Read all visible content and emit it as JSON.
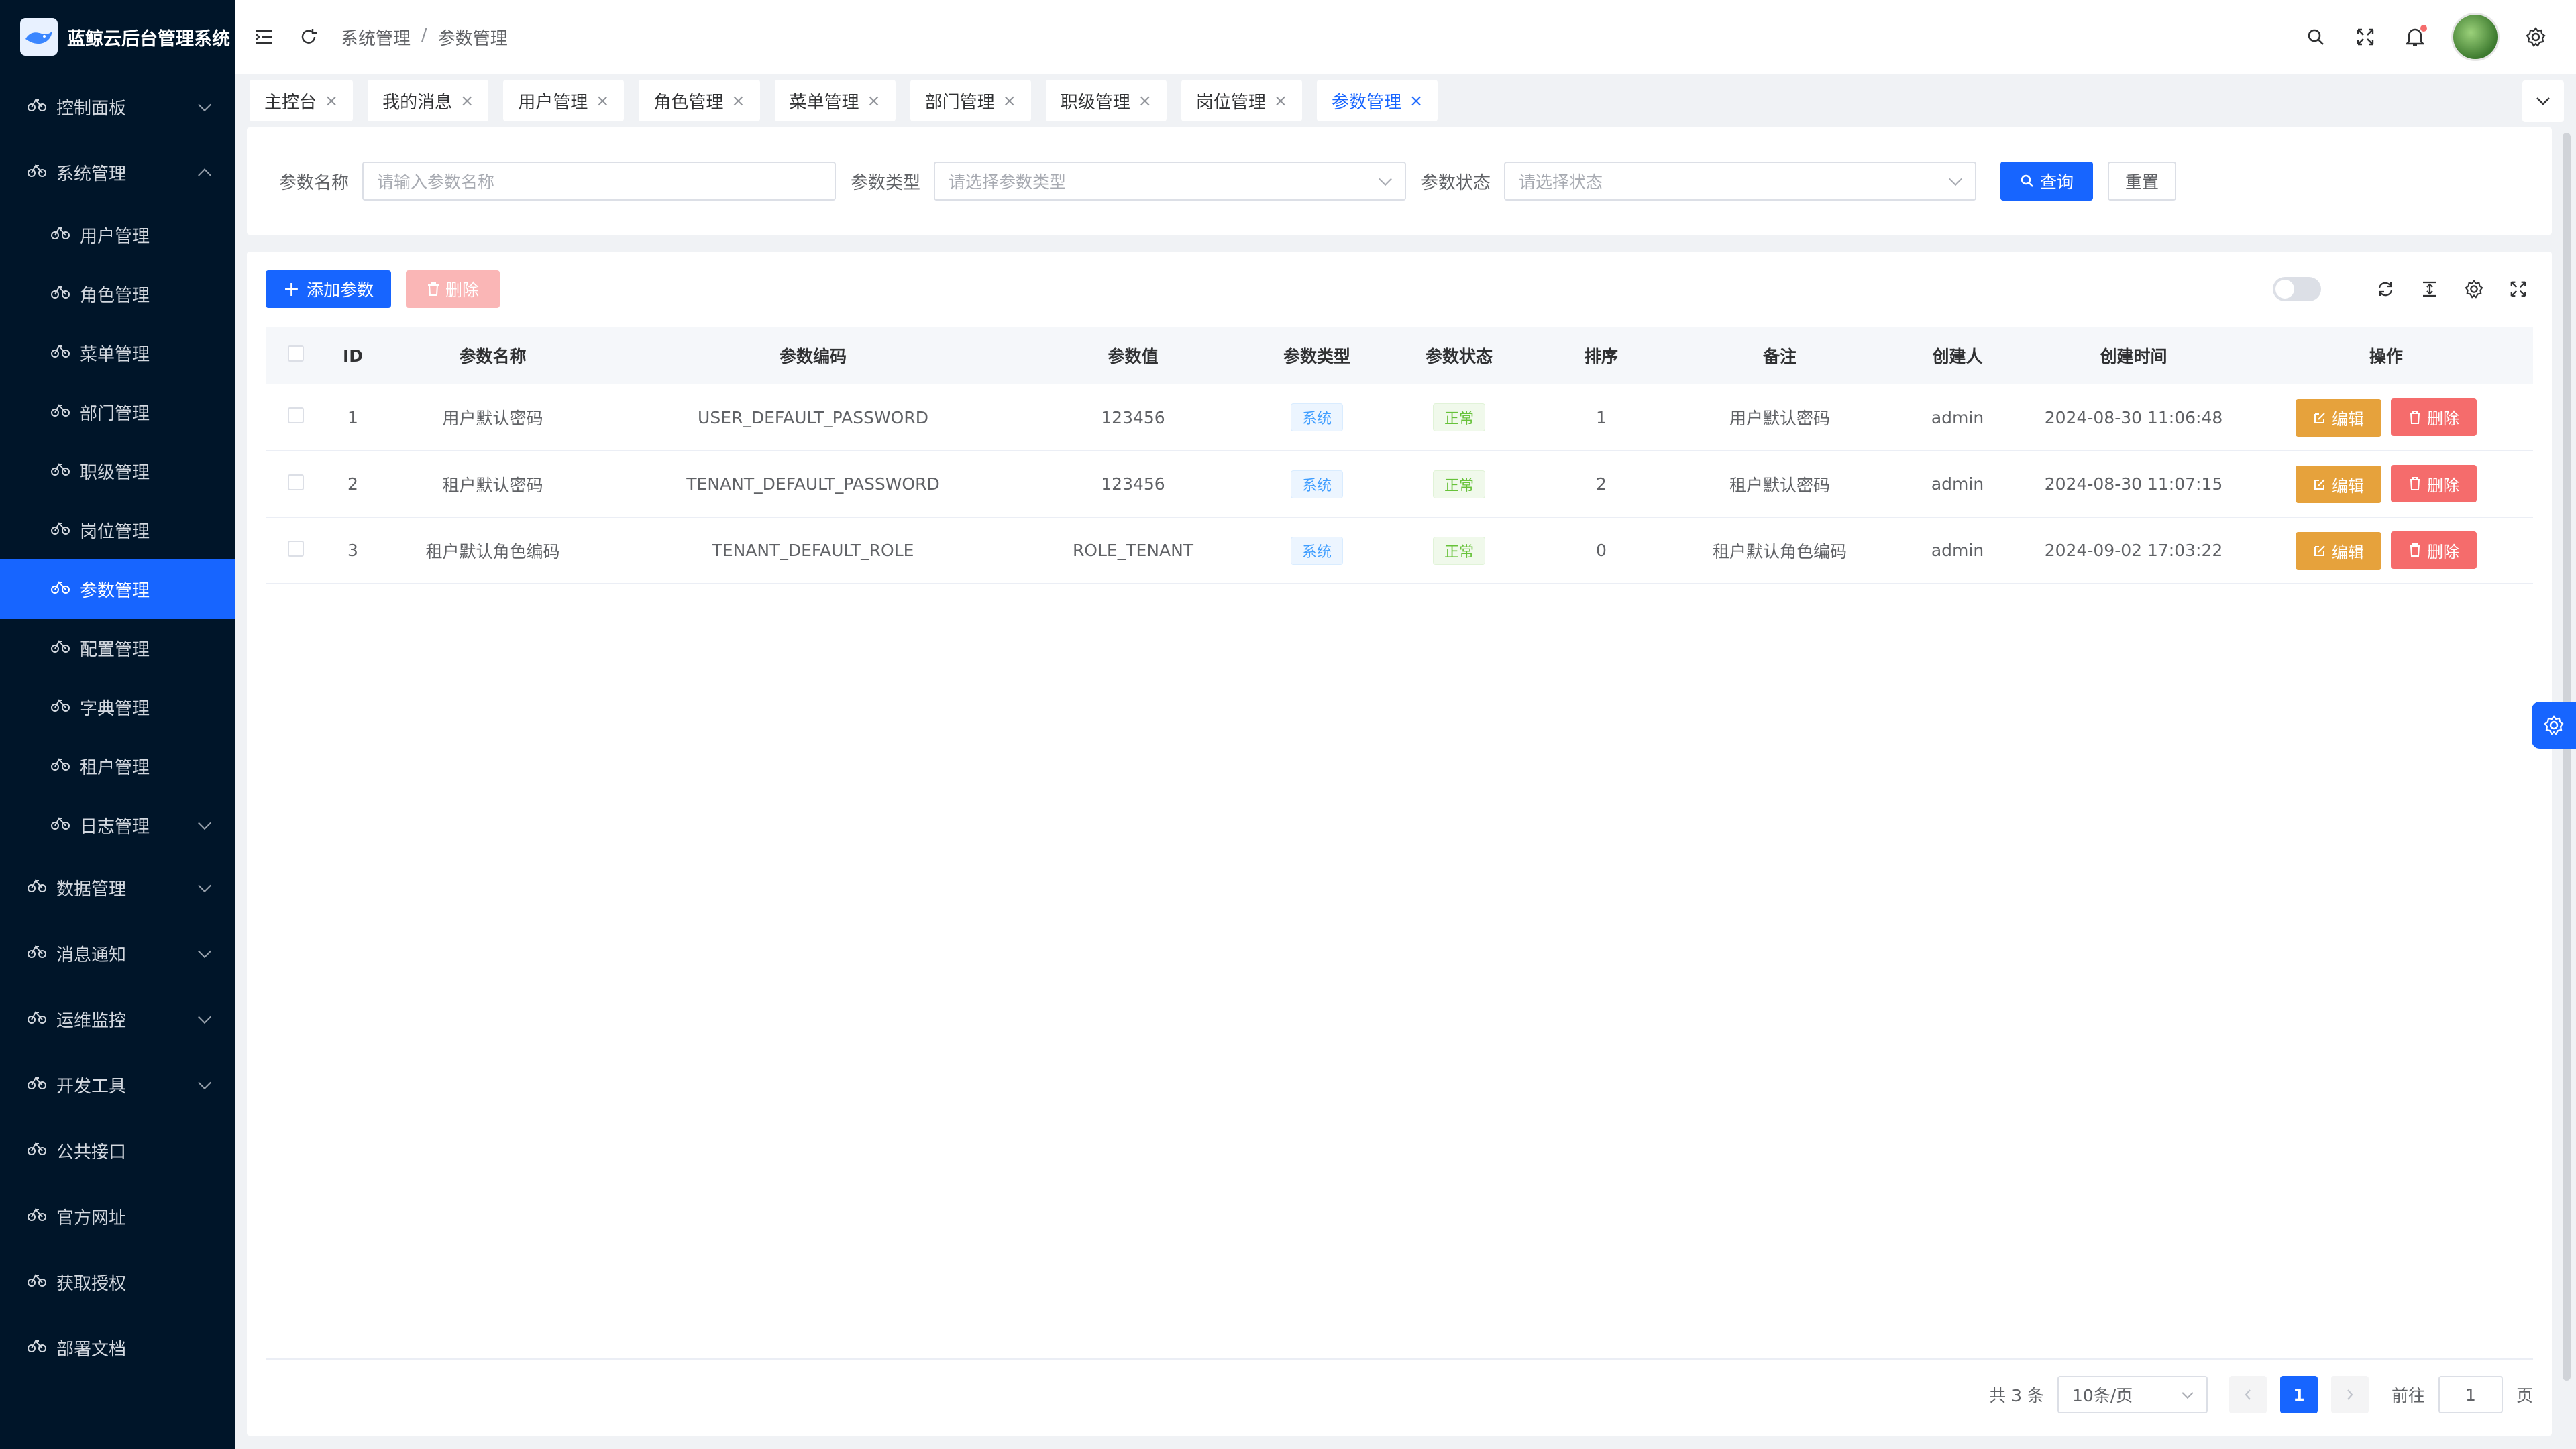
{
  "app": {
    "title": "蓝鲸云后台管理系统"
  },
  "sidebar": {
    "items": [
      {
        "label": "控制面板",
        "level": 0,
        "arrow": "down"
      },
      {
        "label": "系统管理",
        "level": 0,
        "arrow": "up"
      },
      {
        "label": "用户管理",
        "level": 1
      },
      {
        "label": "角色管理",
        "level": 1
      },
      {
        "label": "菜单管理",
        "level": 1
      },
      {
        "label": "部门管理",
        "level": 1
      },
      {
        "label": "职级管理",
        "level": 1
      },
      {
        "label": "岗位管理",
        "level": 1
      },
      {
        "label": "参数管理",
        "level": 1,
        "active": true
      },
      {
        "label": "配置管理",
        "level": 1
      },
      {
        "label": "字典管理",
        "level": 1
      },
      {
        "label": "租户管理",
        "level": 1
      },
      {
        "label": "日志管理",
        "level": 1,
        "arrow": "down"
      },
      {
        "label": "数据管理",
        "level": 0,
        "arrow": "down"
      },
      {
        "label": "消息通知",
        "level": 0,
        "arrow": "down"
      },
      {
        "label": "运维监控",
        "level": 0,
        "arrow": "down"
      },
      {
        "label": "开发工具",
        "level": 0,
        "arrow": "down"
      },
      {
        "label": "公共接口",
        "level": 0
      },
      {
        "label": "官方网址",
        "level": 0
      },
      {
        "label": "获取授权",
        "level": 0
      },
      {
        "label": "部署文档",
        "level": 0
      }
    ]
  },
  "header": {
    "breadcrumb": [
      "系统管理",
      "参数管理"
    ],
    "separator": "/"
  },
  "tabs": [
    "主控台",
    "我的消息",
    "用户管理",
    "角色管理",
    "菜单管理",
    "部门管理",
    "职级管理",
    "岗位管理",
    "参数管理"
  ],
  "active_tab": "参数管理",
  "search": {
    "name_label": "参数名称",
    "name_placeholder": "请输入参数名称",
    "type_label": "参数类型",
    "type_placeholder": "请选择参数类型",
    "status_label": "参数状态",
    "status_placeholder": "请选择状态",
    "query_button": "查询",
    "reset_button": "重置"
  },
  "toolbar": {
    "add_button": "添加参数",
    "delete_button": "删除"
  },
  "table": {
    "columns": [
      "ID",
      "参数名称",
      "参数编码",
      "参数值",
      "参数类型",
      "参数状态",
      "排序",
      "备注",
      "创建人",
      "创建时间",
      "操作"
    ],
    "rows": [
      {
        "id": "1",
        "name": "用户默认密码",
        "code": "USER_DEFAULT_PASSWORD",
        "value": "123456",
        "type": "系统",
        "status": "正常",
        "sort": "1",
        "remark": "用户默认密码",
        "creator": "admin",
        "created": "2024-08-30 11:06:48"
      },
      {
        "id": "2",
        "name": "租户默认密码",
        "code": "TENANT_DEFAULT_PASSWORD",
        "value": "123456",
        "type": "系统",
        "status": "正常",
        "sort": "2",
        "remark": "租户默认密码",
        "creator": "admin",
        "created": "2024-08-30 11:07:15"
      },
      {
        "id": "3",
        "name": "租户默认角色编码",
        "code": "TENANT_DEFAULT_ROLE",
        "value": "ROLE_TENANT",
        "type": "系统",
        "status": "正常",
        "sort": "0",
        "remark": "租户默认角色编码",
        "creator": "admin",
        "created": "2024-09-02 17:03:22"
      }
    ],
    "edit_label": "编辑",
    "delete_label": "删除"
  },
  "pagination": {
    "total_text": "共 3 条",
    "page_size": "10条/页",
    "current_page": "1",
    "goto_prefix": "前往",
    "goto_value": "1",
    "goto_suffix": "页"
  },
  "colors": {
    "sidebar_bg": "#001529",
    "primary": "#1765ff",
    "warning": "#e6a23c",
    "danger": "#f56c6c"
  }
}
